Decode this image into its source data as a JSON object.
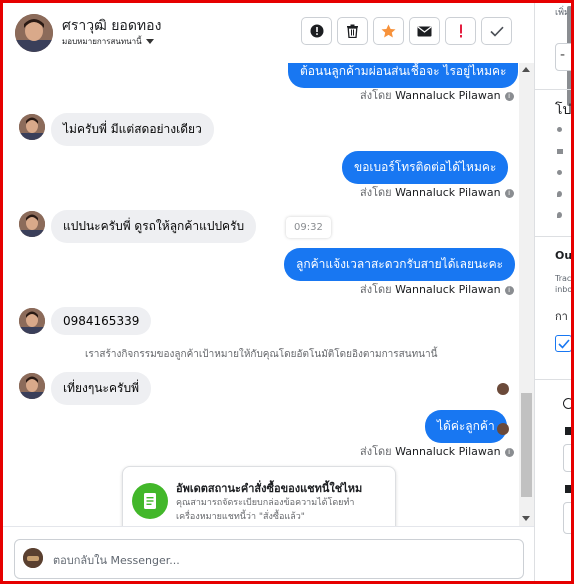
{
  "header": {
    "contact_name": "ศราวุฒิ ยอดทอง",
    "assign_label": "มอบหมายการสนทนานี้",
    "toolbar": [
      {
        "name": "mark-spam-button",
        "icon": "alert-circle-icon"
      },
      {
        "name": "delete-button",
        "icon": "trash-icon"
      },
      {
        "name": "star-button",
        "icon": "star-icon"
      },
      {
        "name": "mark-unread-button",
        "icon": "envelope-icon"
      },
      {
        "name": "follow-up-button",
        "icon": "exclamation-icon"
      },
      {
        "name": "mark-done-button",
        "icon": "check-icon"
      }
    ]
  },
  "colors": {
    "accent": "#1877f2",
    "star": "#f7923b",
    "follow_up": "#e41e3f",
    "card_icon_bg": "#42b72a"
  },
  "conversation": {
    "messages": [
      {
        "id": "out1",
        "direction": "outgoing",
        "text": "ต้อนนลูกค้ามผ่อนส่นเชื้อจะ ไรอยู่ไหมคะ",
        "sent_by_prefix": "ส่งโดย",
        "sent_by_name": "Wannaluck Pilawan"
      },
      {
        "id": "in1",
        "direction": "incoming",
        "text": "ไม่ครับพี่ มีแต่สดอย่างเดียว"
      },
      {
        "id": "out2",
        "direction": "outgoing",
        "text": "ขอเบอร์โทรติดต่อได้ไหมคะ",
        "sent_by_prefix": "ส่งโดย",
        "sent_by_name": "Wannaluck Pilawan"
      },
      {
        "id": "in2",
        "direction": "incoming",
        "text": "แปปนะครับพี่ ดูรถให้ลูกค้าแปปครับ"
      },
      {
        "id": "out3",
        "direction": "outgoing",
        "text": "ลูกค้าแจ้งเวลาสะดวกรับสายได้เลยนะคะ",
        "sent_by_prefix": "ส่งโดย",
        "sent_by_name": "Wannaluck Pilawan"
      },
      {
        "id": "in3",
        "direction": "incoming",
        "text": "0984165339"
      },
      {
        "id": "in4",
        "direction": "incoming",
        "text": "เที่ยงๆนะครับพี่"
      },
      {
        "id": "out4",
        "direction": "outgoing",
        "text": "ได้ค่ะลูกค้า",
        "sent_by_prefix": "ส่งโดย",
        "sent_by_name": "Wannaluck Pilawan"
      }
    ],
    "time_tooltip": "09:32",
    "system_note": "เราสร้างกิจกรรมของลูกค้าเป้าหมายให้กับคุณโดยอัตโนมัติโดยอิงตามการสนทนานี้",
    "suggestion_card": {
      "title": "อัพเดตสถานะคำสั่งซื้อของแชทนี้ใช่ไหม",
      "description": "คุณสามารถจัดระเบียบกล่องข้อความได้โดยทำเครื่องหมายแชทนี้ว่า \"สั่งซื้อแล้ว\"",
      "icon": "order-document-icon"
    }
  },
  "composer": {
    "placeholder": "ตอบกลับใน Messenger..."
  },
  "right_panel": {
    "add_label": "เพิ่ม",
    "section_label": "โป",
    "outcome_label": "Ou",
    "tracking_lines": [
      "Trac",
      "inbo"
    ],
    "ka_label": "กา"
  }
}
